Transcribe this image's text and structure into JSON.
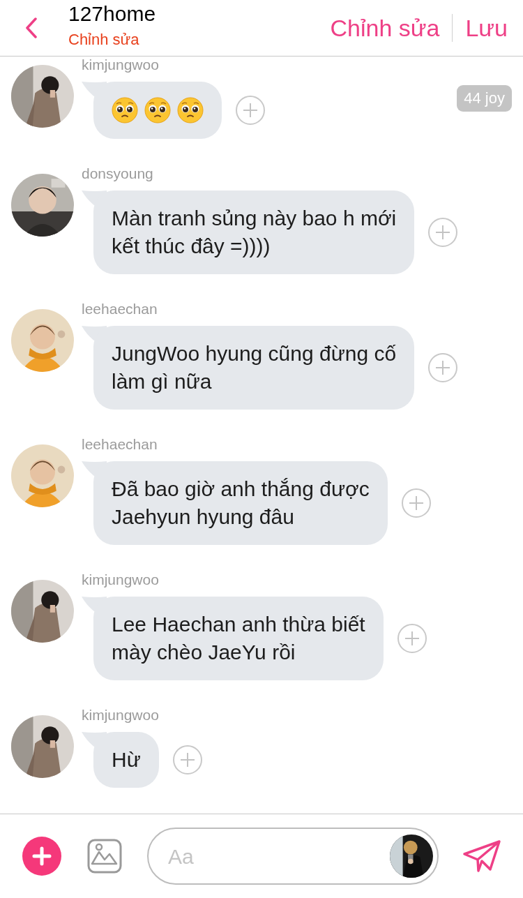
{
  "header": {
    "title": "127home",
    "subtitle": "Chỉnh sửa",
    "actions": [
      "Chỉnh sửa",
      "Lưu"
    ]
  },
  "messages": [
    {
      "sender": "kimjungwoo",
      "avatar": {
        "kind": "picture"
      },
      "kind": "emoji",
      "emoji": [
        {
          "kind": "pleading-face"
        },
        {
          "kind": "pleading-face"
        },
        {
          "kind": "pleading-face"
        }
      ],
      "badge": "44 joy"
    },
    {
      "sender": "donsyoung",
      "avatar": {
        "kind": "picture"
      },
      "kind": "text",
      "lines": [
        "Màn tranh sủng này bao h mới",
        "kết thúc đây =))))"
      ]
    },
    {
      "sender": "leehaechan",
      "avatar": {
        "kind": "picture"
      },
      "kind": "text",
      "lines": [
        "JungWoo hyung cũng đừng cố",
        "làm gì nữa"
      ]
    },
    {
      "sender": "leehaechan",
      "avatar": {
        "kind": "picture"
      },
      "kind": "text",
      "lines": [
        "Đã bao giờ anh thắng được",
        "Jaehyun hyung đâu"
      ]
    },
    {
      "sender": "kimjungwoo",
      "avatar": {
        "kind": "picture"
      },
      "kind": "text",
      "lines": [
        "Lee Haechan anh thừa biết",
        "mày chèo JaeYu rồi"
      ]
    },
    {
      "sender": "kimjungwoo",
      "avatar": {
        "kind": "picture"
      },
      "kind": "text",
      "lines": [
        "Hừ"
      ]
    }
  ],
  "composer": {
    "placeholder": "Aa",
    "avatar": {
      "kind": "picture"
    }
  }
}
